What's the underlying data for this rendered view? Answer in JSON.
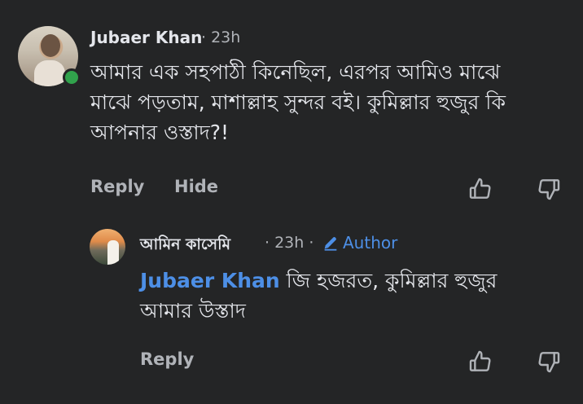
{
  "comment": {
    "author": "Jubaer Khan",
    "time": "· 23h",
    "text": "আমার এক সহপাঠী কিনেছিল, এরপর আমিও মাঝে মাঝে পড়তাম, মাশাল্লাহ সুন্দর বই। কুমিল্লার হুজুর কি আপনার ওস্তাদ?!",
    "reply_label": "Reply",
    "hide_label": "Hide",
    "online": true
  },
  "reply": {
    "author": "আমিন কাসেমি",
    "time": "· 23h ·",
    "badge": "Author",
    "mention": "Jubaer Khan",
    "text": " জি হজরত, কুমিল্লার হুজুর আমার উস্তাদ",
    "reply_label": "Reply"
  },
  "icons": {
    "like": "thumbs-up-icon",
    "dislike": "thumbs-down-icon",
    "author_badge": "pencil-icon"
  },
  "colors": {
    "background": "#242526",
    "text": "#e4e6eb",
    "muted": "#b0b3b8",
    "accent": "#4d8fe6",
    "online": "#31a24c"
  }
}
